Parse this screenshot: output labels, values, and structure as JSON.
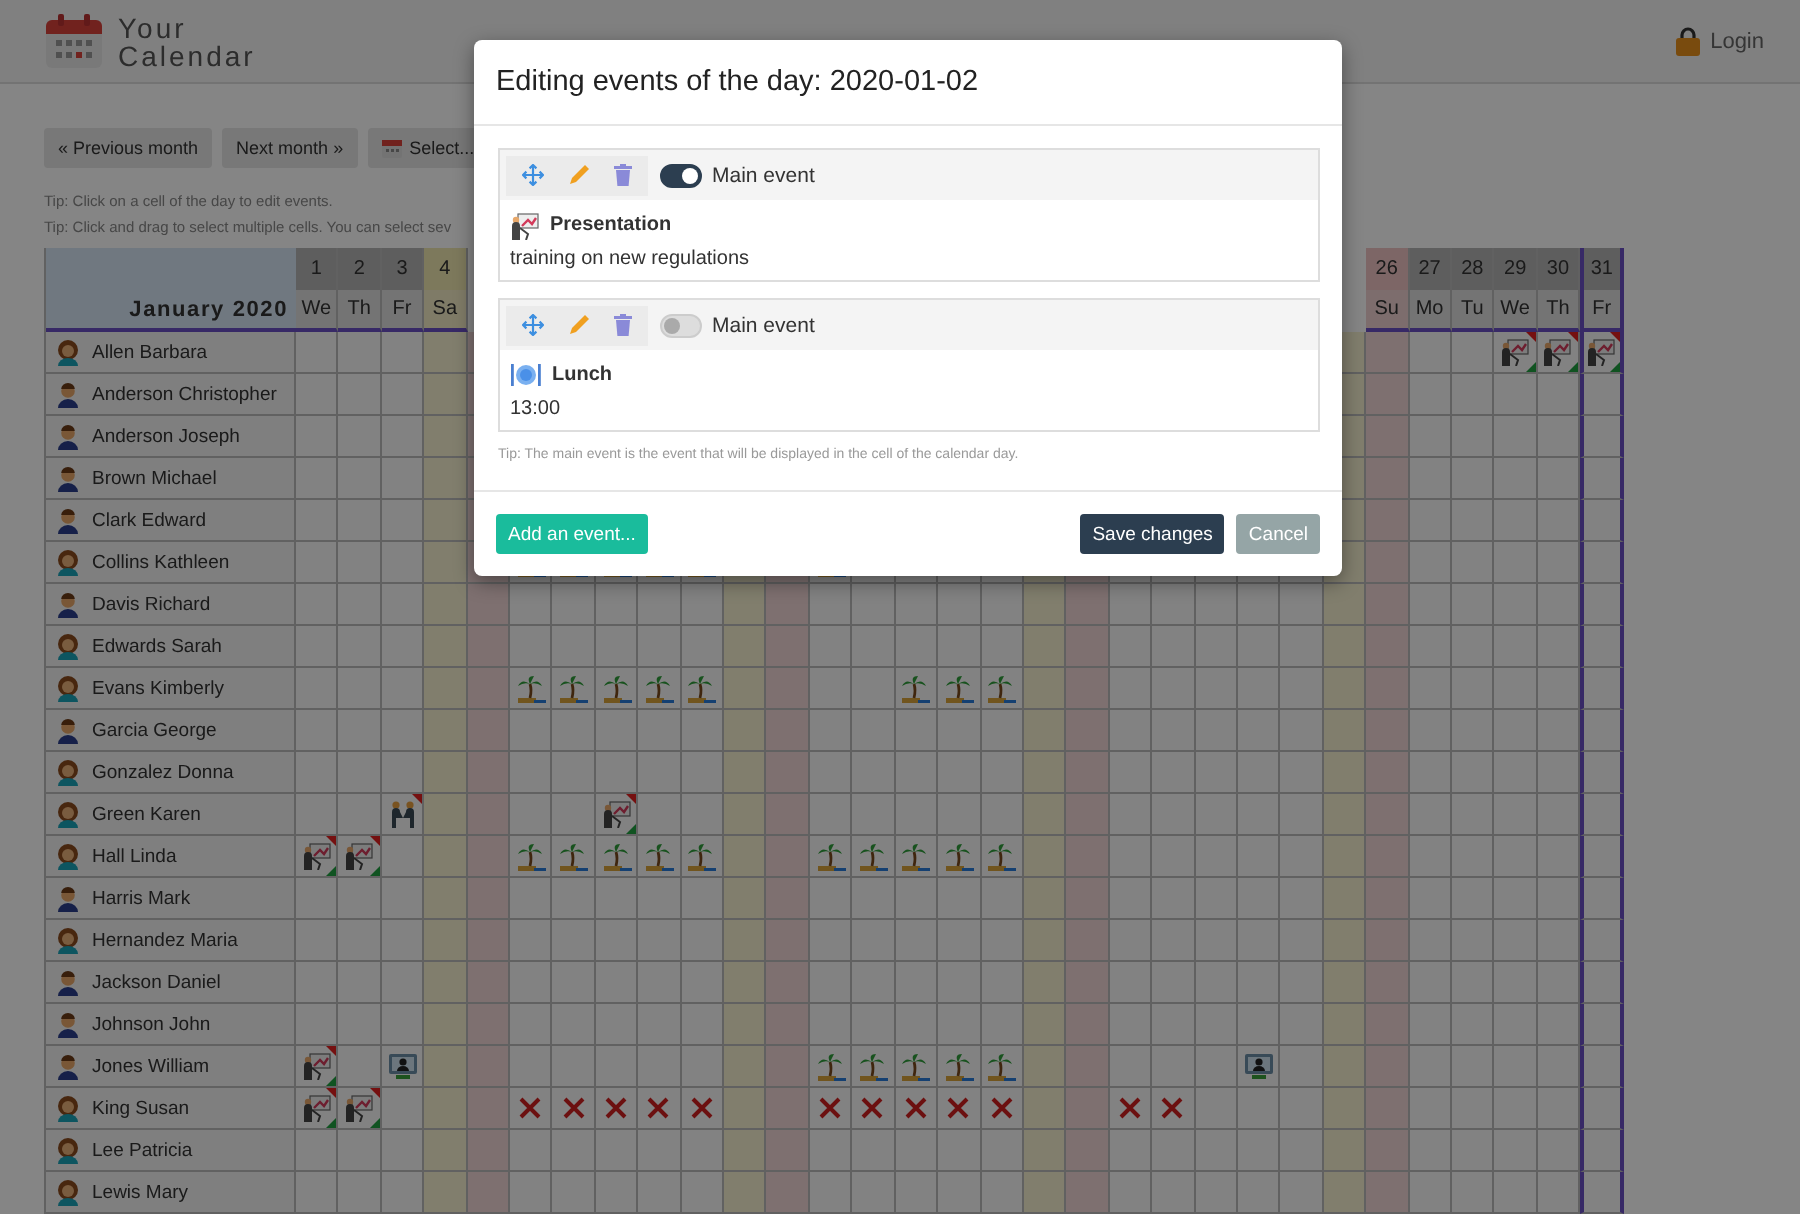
{
  "header": {
    "logo_line_1": "Your",
    "logo_line_2": "Calendar",
    "login": "Login"
  },
  "toolbar": {
    "buttons": [
      {
        "label": "« Previous month",
        "kind": "plain"
      },
      {
        "label": "Next month »",
        "kind": "plain"
      },
      {
        "label": "Select...",
        "kind": "calendar"
      }
    ],
    "tips": [
      "Tip: Click on a cell of the day to edit events.",
      "Tip: Click and drag to select multiple cells. You can select sev"
    ]
  },
  "calendar": {
    "month": "January 2020",
    "columns": [
      {
        "day": "1",
        "weekday": "We",
        "kind": "weekday",
        "selected": false
      },
      {
        "day": "2",
        "weekday": "Th",
        "kind": "weekday",
        "selected": false
      },
      {
        "day": "3",
        "weekday": "Fr",
        "kind": "weekday",
        "selected": false
      },
      {
        "day": "4",
        "weekday": "Sa",
        "kind": "saturday",
        "selected": false
      },
      {
        "kind": "sunday"
      },
      {
        "kind": "weekday"
      },
      {
        "kind": "weekday"
      },
      {
        "kind": "weekday"
      },
      {
        "kind": "weekday"
      },
      {
        "kind": "weekday"
      },
      {
        "kind": "saturday"
      },
      {
        "kind": "sunday"
      },
      {
        "kind": "weekday"
      },
      {
        "kind": "weekday"
      },
      {
        "kind": "weekday"
      },
      {
        "kind": "weekday"
      },
      {
        "kind": "weekday"
      },
      {
        "kind": "saturday"
      },
      {
        "kind": "sunday"
      },
      {
        "kind": "weekday"
      },
      {
        "kind": "weekday"
      },
      {
        "kind": "weekday"
      },
      {
        "kind": "weekday"
      },
      {
        "kind": "weekday"
      },
      {
        "kind": "saturday"
      },
      {
        "day": "26",
        "weekday": "Su",
        "kind": "sunday",
        "selected": false
      },
      {
        "day": "27",
        "weekday": "Mo",
        "kind": "weekday",
        "selected": false
      },
      {
        "day": "28",
        "weekday": "Tu",
        "kind": "weekday",
        "selected": false
      },
      {
        "day": "29",
        "weekday": "We",
        "kind": "weekday",
        "selected": false
      },
      {
        "day": "30",
        "weekday": "Th",
        "kind": "weekday",
        "selected": false
      },
      {
        "day": "31",
        "weekday": "Fr",
        "kind": "weekday",
        "selected": true
      }
    ],
    "rows": [
      {
        "name": "Allen Barbara",
        "kind": "female",
        "cells": [
          {
            "kind": "empty"
          },
          {
            "kind": "empty"
          },
          {
            "kind": "empty"
          },
          {
            "kind": "empty"
          },
          {
            "kind": "empty"
          },
          {
            "kind": "empty"
          },
          {
            "kind": "empty"
          },
          {
            "kind": "empty"
          },
          {
            "kind": "empty"
          },
          {
            "kind": "empty"
          },
          {
            "kind": "empty"
          },
          {
            "kind": "empty"
          },
          {
            "kind": "empty"
          },
          {
            "kind": "empty"
          },
          {
            "kind": "empty"
          },
          {
            "kind": "empty"
          },
          {
            "kind": "empty"
          },
          {
            "kind": "empty"
          },
          {
            "kind": "empty"
          },
          {
            "kind": "empty"
          },
          {
            "kind": "empty"
          },
          {
            "kind": "empty"
          },
          {
            "kind": "empty"
          },
          {
            "kind": "empty"
          },
          {
            "kind": "empty"
          },
          {
            "kind": "empty"
          },
          {
            "kind": "empty"
          },
          {
            "kind": "empty"
          },
          {
            "kind": "presentation"
          },
          {
            "kind": "presentation"
          },
          {
            "kind": "presentation"
          }
        ]
      },
      {
        "name": "Anderson Christopher",
        "kind": "male"
      },
      {
        "name": "Anderson Joseph",
        "kind": "male"
      },
      {
        "name": "Brown Michael",
        "kind": "male"
      },
      {
        "name": "Clark Edward",
        "kind": "male"
      },
      {
        "name": "Collins Kathleen",
        "kind": "female",
        "cells": [
          {
            "kind": "empty"
          },
          {
            "kind": "empty"
          },
          {
            "kind": "empty"
          },
          {
            "kind": "empty"
          },
          {
            "kind": "empty"
          },
          {
            "kind": "vacation"
          },
          {
            "kind": "vacation"
          },
          {
            "kind": "vacation"
          },
          {
            "kind": "vacation"
          },
          {
            "kind": "vacation"
          },
          {
            "kind": "empty"
          },
          {
            "kind": "empty"
          },
          {
            "kind": "vacation"
          }
        ]
      },
      {
        "name": "Davis Richard",
        "kind": "male"
      },
      {
        "name": "Edwards Sarah",
        "kind": "female"
      },
      {
        "name": "Evans Kimberly",
        "kind": "female",
        "cells": [
          {
            "kind": "empty"
          },
          {
            "kind": "empty"
          },
          {
            "kind": "empty"
          },
          {
            "kind": "empty"
          },
          {
            "kind": "empty"
          },
          {
            "kind": "vacation"
          },
          {
            "kind": "vacation"
          },
          {
            "kind": "vacation"
          },
          {
            "kind": "vacation"
          },
          {
            "kind": "vacation"
          },
          {
            "kind": "empty"
          },
          {
            "kind": "empty"
          },
          {
            "kind": "empty"
          },
          {
            "kind": "empty"
          },
          {
            "kind": "vacation"
          },
          {
            "kind": "vacation"
          },
          {
            "kind": "vacation"
          }
        ]
      },
      {
        "name": "Garcia George",
        "kind": "male"
      },
      {
        "name": "Gonzalez Donna",
        "kind": "female"
      },
      {
        "name": "Green Karen",
        "kind": "female",
        "cells": [
          {
            "kind": "empty"
          },
          {
            "kind": "empty"
          },
          {
            "kind": "meeting"
          },
          {
            "kind": "empty"
          },
          {
            "kind": "empty"
          },
          {
            "kind": "empty"
          },
          {
            "kind": "empty"
          },
          {
            "kind": "presentation"
          }
        ]
      },
      {
        "name": "Hall Linda",
        "kind": "female",
        "cells": [
          {
            "kind": "presentation"
          },
          {
            "kind": "presentation"
          },
          {
            "kind": "empty"
          },
          {
            "kind": "empty"
          },
          {
            "kind": "empty"
          },
          {
            "kind": "vacation"
          },
          {
            "kind": "vacation"
          },
          {
            "kind": "vacation"
          },
          {
            "kind": "vacation"
          },
          {
            "kind": "vacation"
          },
          {
            "kind": "empty"
          },
          {
            "kind": "empty"
          },
          {
            "kind": "vacation"
          },
          {
            "kind": "vacation"
          },
          {
            "kind": "vacation"
          },
          {
            "kind": "vacation"
          },
          {
            "kind": "vacation"
          }
        ]
      },
      {
        "name": "Harris Mark",
        "kind": "male"
      },
      {
        "name": "Hernandez Maria",
        "kind": "female"
      },
      {
        "name": "Jackson Daniel",
        "kind": "male"
      },
      {
        "name": "Johnson John",
        "kind": "male"
      },
      {
        "name": "Jones William",
        "kind": "male",
        "cells": [
          {
            "kind": "presentation"
          },
          {
            "kind": "empty"
          },
          {
            "kind": "videocall"
          },
          {
            "kind": "empty"
          },
          {
            "kind": "empty"
          },
          {
            "kind": "empty"
          },
          {
            "kind": "empty"
          },
          {
            "kind": "empty"
          },
          {
            "kind": "empty"
          },
          {
            "kind": "empty"
          },
          {
            "kind": "empty"
          },
          {
            "kind": "empty"
          },
          {
            "kind": "vacation"
          },
          {
            "kind": "vacation"
          },
          {
            "kind": "vacation"
          },
          {
            "kind": "vacation"
          },
          {
            "kind": "vacation"
          },
          {
            "kind": "empty"
          },
          {
            "kind": "empty"
          },
          {
            "kind": "empty"
          },
          {
            "kind": "empty"
          },
          {
            "kind": "empty"
          },
          {
            "kind": "videocall"
          }
        ]
      },
      {
        "name": "King Susan",
        "kind": "female",
        "cells": [
          {
            "kind": "presentation"
          },
          {
            "kind": "presentation"
          },
          {
            "kind": "empty"
          },
          {
            "kind": "empty"
          },
          {
            "kind": "empty"
          },
          {
            "kind": "absent"
          },
          {
            "kind": "absent"
          },
          {
            "kind": "absent"
          },
          {
            "kind": "absent"
          },
          {
            "kind": "absent"
          },
          {
            "kind": "empty"
          },
          {
            "kind": "empty"
          },
          {
            "kind": "absent"
          },
          {
            "kind": "absent"
          },
          {
            "kind": "absent"
          },
          {
            "kind": "absent"
          },
          {
            "kind": "absent"
          },
          {
            "kind": "empty"
          },
          {
            "kind": "empty"
          },
          {
            "kind": "absent"
          },
          {
            "kind": "absent"
          }
        ]
      },
      {
        "name": "Lee Patricia",
        "kind": "female"
      },
      {
        "name": "Lewis Mary",
        "kind": "female"
      }
    ]
  },
  "modal": {
    "title": "Editing events of the day: 2020-01-02",
    "events": [
      {
        "main": true,
        "main_label": "Main event",
        "kind": "presentation",
        "title": "Presentation",
        "description": "training on new regulations"
      },
      {
        "main": false,
        "main_label": "Main event",
        "kind": "lunch",
        "title": "Lunch",
        "description": "13:00"
      }
    ],
    "tip": "Tip: The main event is the event that will be displayed in the cell of the calendar day.",
    "add_button": "Add an event...",
    "save_button": "Save changes",
    "cancel_button": "Cancel"
  }
}
